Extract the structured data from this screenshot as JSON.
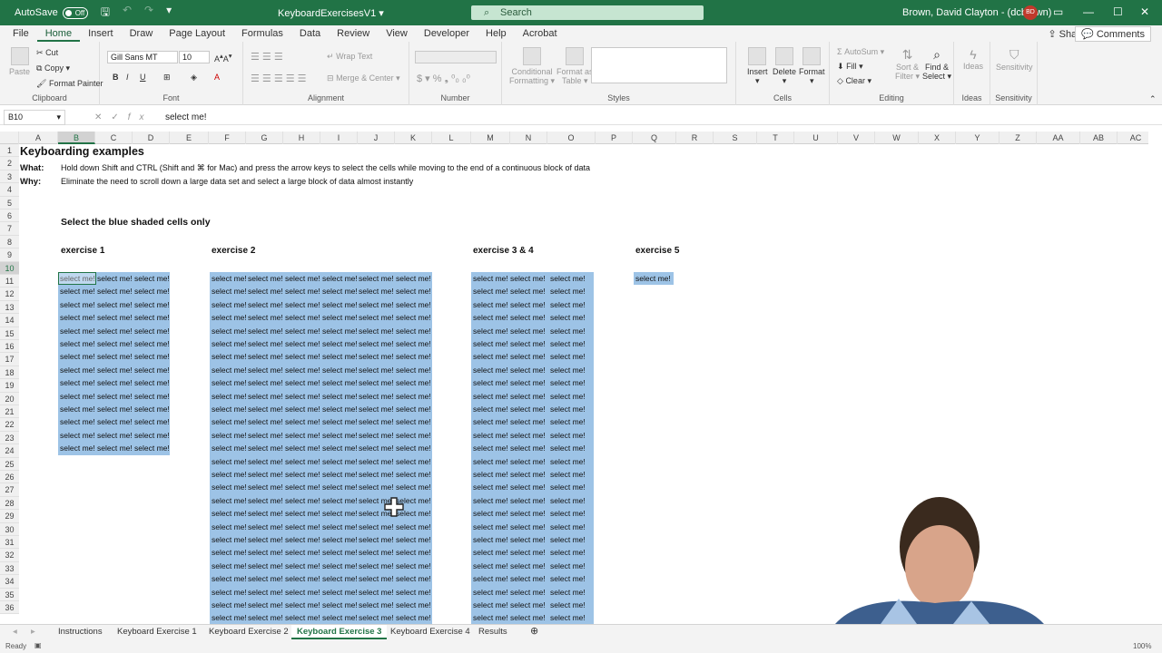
{
  "titlebar": {
    "autosave_label": "AutoSave",
    "autosave_state": "Off",
    "doc_title": "KeyboardExercisesV1",
    "search_placeholder": "Search",
    "user_name": "Brown, David Clayton - (dcbrown)",
    "avatar_initials": "BD"
  },
  "menu": {
    "tabs": [
      "File",
      "Home",
      "Insert",
      "Draw",
      "Page Layout",
      "Formulas",
      "Data",
      "Review",
      "View",
      "Developer",
      "Help",
      "Acrobat"
    ],
    "active": "Home",
    "share": "Share",
    "comments": "Comments"
  },
  "ribbon": {
    "clipboard": {
      "label": "Clipboard",
      "paste": "Paste",
      "cut": "Cut",
      "copy": "Copy",
      "format_painter": "Format Painter"
    },
    "font": {
      "label": "Font",
      "font_name": "Gill Sans MT",
      "font_size": "10"
    },
    "alignment": {
      "label": "Alignment",
      "wrap": "Wrap Text",
      "merge": "Merge & Center"
    },
    "number": {
      "label": "Number"
    },
    "styles": {
      "label": "Styles",
      "conditional": "Conditional",
      "formatting": "Formatting",
      "format_as": "Format as",
      "table": "Table"
    },
    "cells": {
      "label": "Cells",
      "insert": "Insert",
      "delete": "Delete",
      "format": "Format"
    },
    "editing": {
      "label": "Editing",
      "autosum": "AutoSum",
      "fill": "Fill",
      "clear": "Clear",
      "sort": "Sort &",
      "filter": "Filter",
      "find": "Find &",
      "select": "Select"
    },
    "ideas": {
      "label": "Ideas",
      "ideas": "Ideas"
    },
    "sensitivity": {
      "label": "Sensitivity",
      "sensitivity": "Sensitivity"
    }
  },
  "formula_bar": {
    "name_box": "B10",
    "formula": "select me!"
  },
  "columns": [
    "A",
    "B",
    "C",
    "D",
    "E",
    "F",
    "G",
    "H",
    "I",
    "J",
    "K",
    "L",
    "M",
    "N",
    "O",
    "P",
    "Q",
    "R",
    "S",
    "T",
    "U",
    "V",
    "W",
    "X",
    "Y",
    "Z",
    "AA",
    "AB",
    "AC"
  ],
  "rows": [
    "1",
    "2",
    "3",
    "4",
    "5",
    "6",
    "7",
    "8",
    "9",
    "10",
    "11",
    "12",
    "13",
    "14",
    "15",
    "16",
    "17",
    "18",
    "19",
    "20",
    "21",
    "22",
    "23",
    "24",
    "25",
    "26",
    "27",
    "28",
    "29",
    "30",
    "31",
    "32",
    "33",
    "34",
    "35",
    "36"
  ],
  "sheet": {
    "title": "Keyboarding examples",
    "what_label": "What:",
    "what_text": "Hold down Shift and CTRL (Shift and ⌘ for Mac) and press the arrow keys to select the cells while moving to the end of a continuous block of data",
    "why_label": "Why:",
    "why_text": "Eliminate the need to scroll down a large data set and select a large block of data almost instantly",
    "instruction": "Select the blue shaded cells only",
    "ex1": "exercise 1",
    "ex2": "exercise 2",
    "ex3": "exercise 3 & 4",
    "ex5": "exercise 5",
    "cell_text": "select me!"
  },
  "sheet_tabs": [
    "Instructions",
    "Keyboard Exercise 1",
    "Keyboard Exercise 2",
    "Keyboard Exercise 3",
    "Keyboard Exercise 4",
    "Results"
  ],
  "active_sheet": "Keyboard Exercise 3",
  "status": {
    "ready": "Ready",
    "zoom": "100%"
  }
}
